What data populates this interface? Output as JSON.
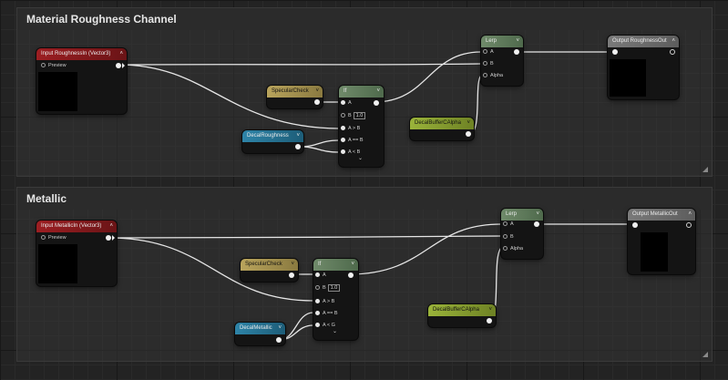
{
  "comments": {
    "roughness": "Material Roughness Channel",
    "metallic": "Metallic"
  },
  "glyphs": {
    "collapse": "˄",
    "expand": "˅",
    "chevron_down": "⌄"
  },
  "roughness": {
    "input_title": "Input RoughnessIn (Vector3)",
    "input_preview": "Preview",
    "specular": "SpecularCheck",
    "if_title": "If",
    "if_a": "A",
    "if_b": "B",
    "if_b_value": "1.0",
    "if_agb": "A > B",
    "if_aeb": "A == B",
    "if_alb": "A < B",
    "decal": "DecalRoughness",
    "lerp_title": "Lerp",
    "lerp_a": "A",
    "lerp_b": "B",
    "lerp_alpha": "Alpha",
    "buffer": "DecalBufferCAlpha",
    "output": "Output RoughnessOut"
  },
  "metallic": {
    "input_title": "Input MetallicIn (Vector3)",
    "input_preview": "Preview",
    "specular": "SpecularCheck",
    "if_title": "If",
    "if_a": "A",
    "if_b": "B",
    "if_b_value": "1.0",
    "if_agb": "A > B",
    "if_aeb": "A == B",
    "if_alb": "A < G",
    "decal": "DecalMetallic",
    "lerp_title": "Lerp",
    "lerp_a": "A",
    "lerp_b": "B",
    "lerp_alpha": "Alpha",
    "buffer": "DecalBufferCAlpha",
    "output": "Output MetallicOut"
  },
  "colors": {
    "input_header": "#9c1e22",
    "lerp_header": "#6f8a6a",
    "specular_header": "#b9a45c",
    "decal_header": "#2e84a8",
    "buffer_header": "#9ab33a",
    "output_header": "#7a7a7a"
  }
}
